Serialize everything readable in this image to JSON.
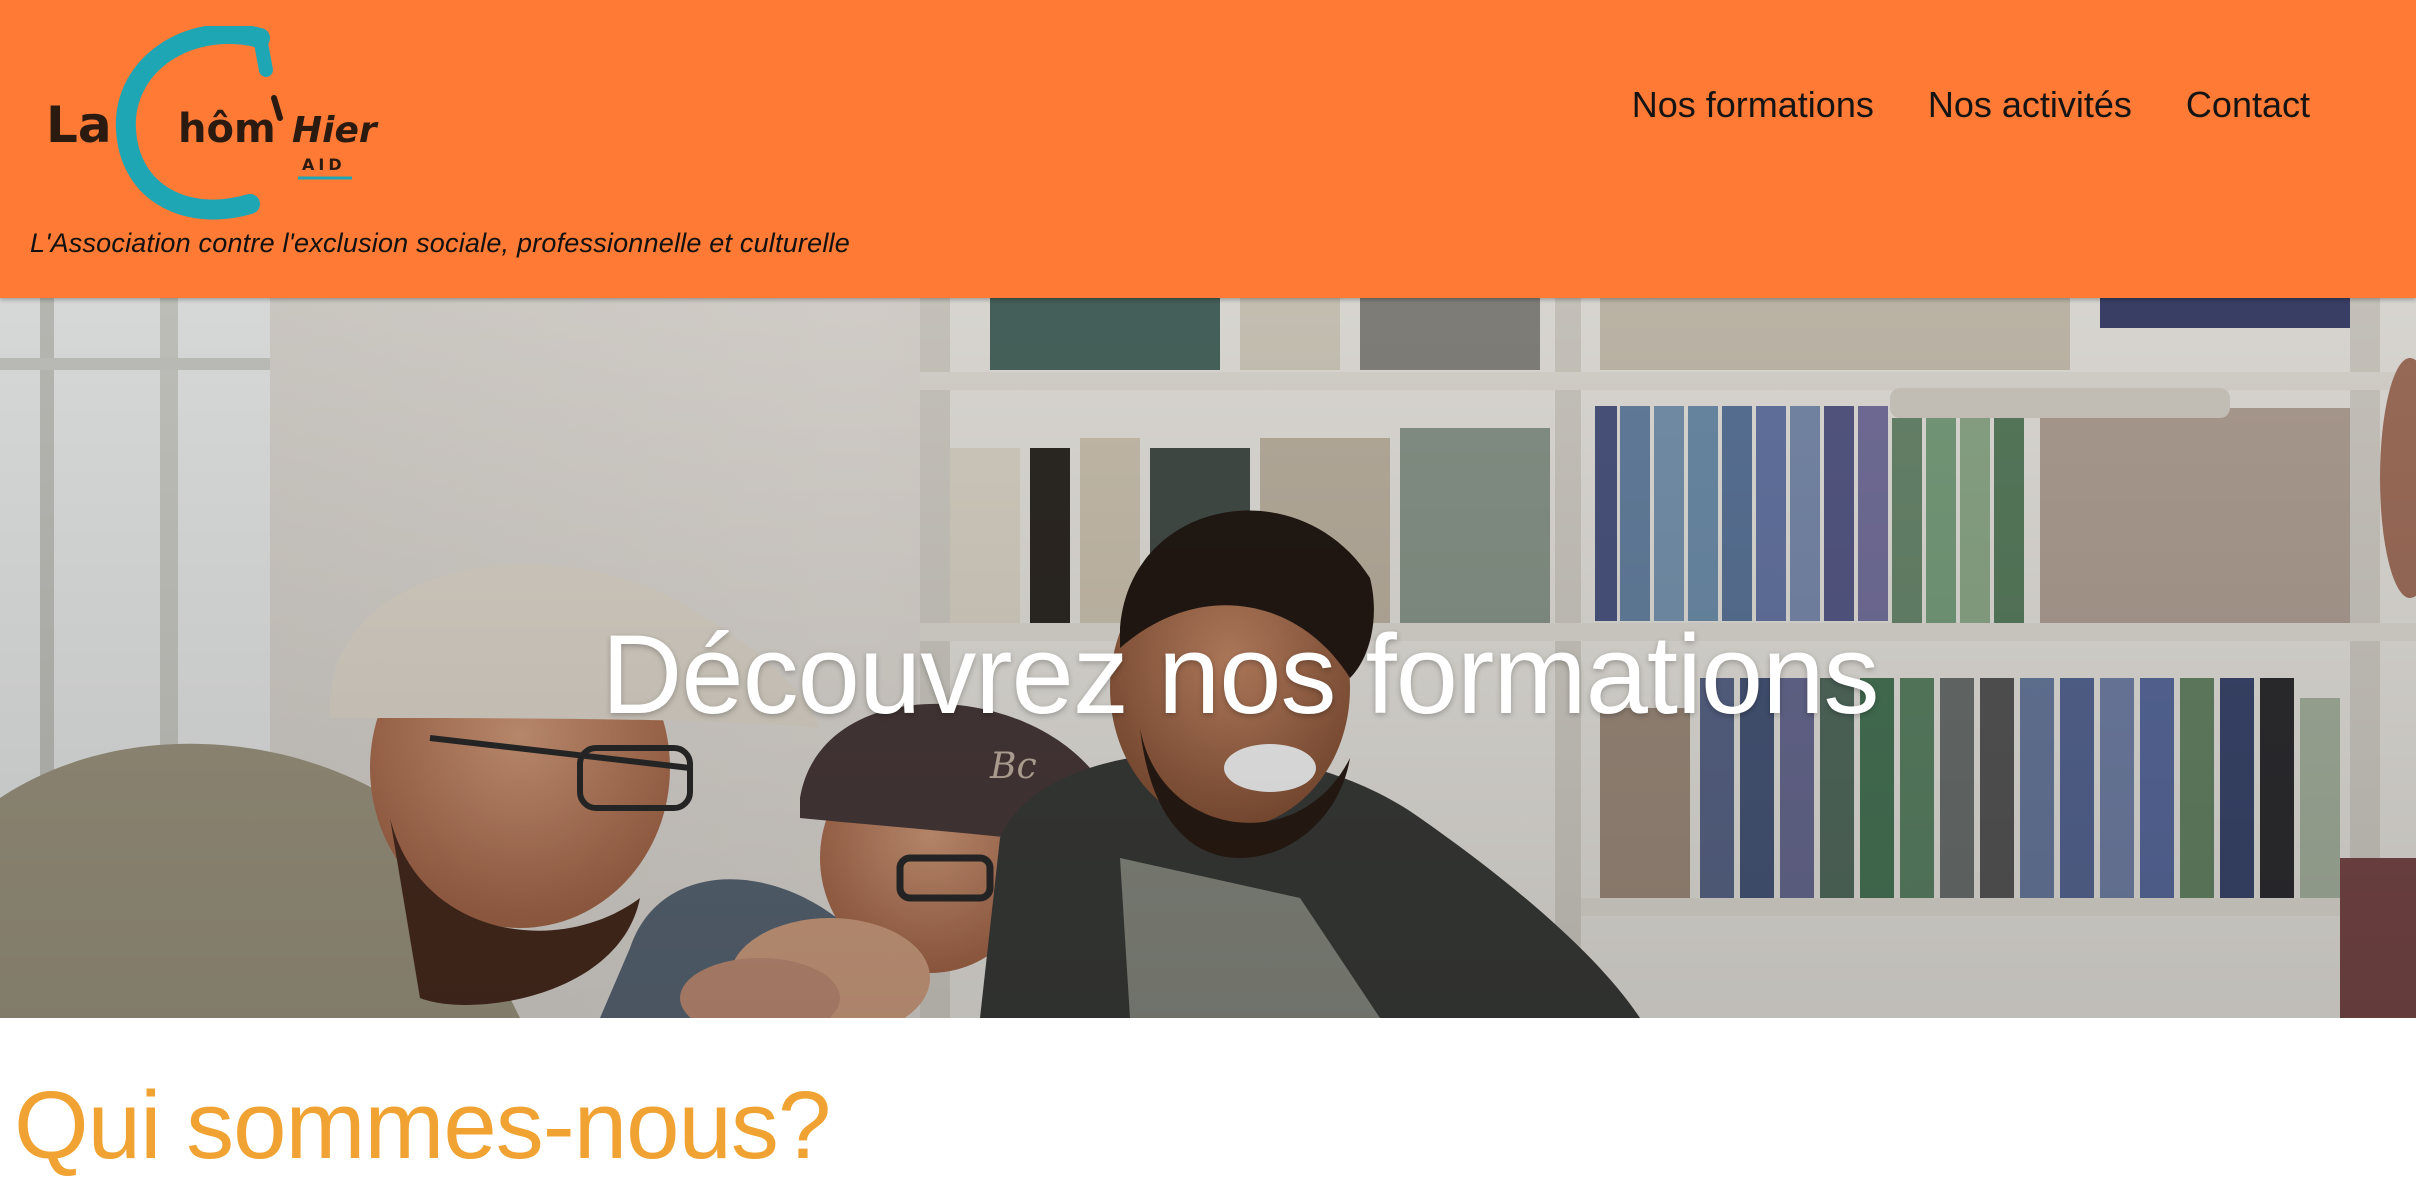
{
  "brand": {
    "logo_text_1": "La",
    "logo_text_2": "hôm",
    "logo_text_3": "Hier",
    "logo_sub": "AID",
    "tagline": "L'Association contre l'exclusion sociale, professionnelle et culturelle"
  },
  "nav": {
    "items": [
      {
        "label": "Nos formations"
      },
      {
        "label": "Nos activités"
      },
      {
        "label": "Contact"
      }
    ]
  },
  "hero": {
    "title": "Découvrez nos formations",
    "image_icon": "group-photo-image"
  },
  "about": {
    "title": "Qui sommes-nous?"
  },
  "colors": {
    "header_bg": "#ff7a35",
    "section_title": "#f0a232",
    "logo_teal": "#1fa6b4"
  }
}
